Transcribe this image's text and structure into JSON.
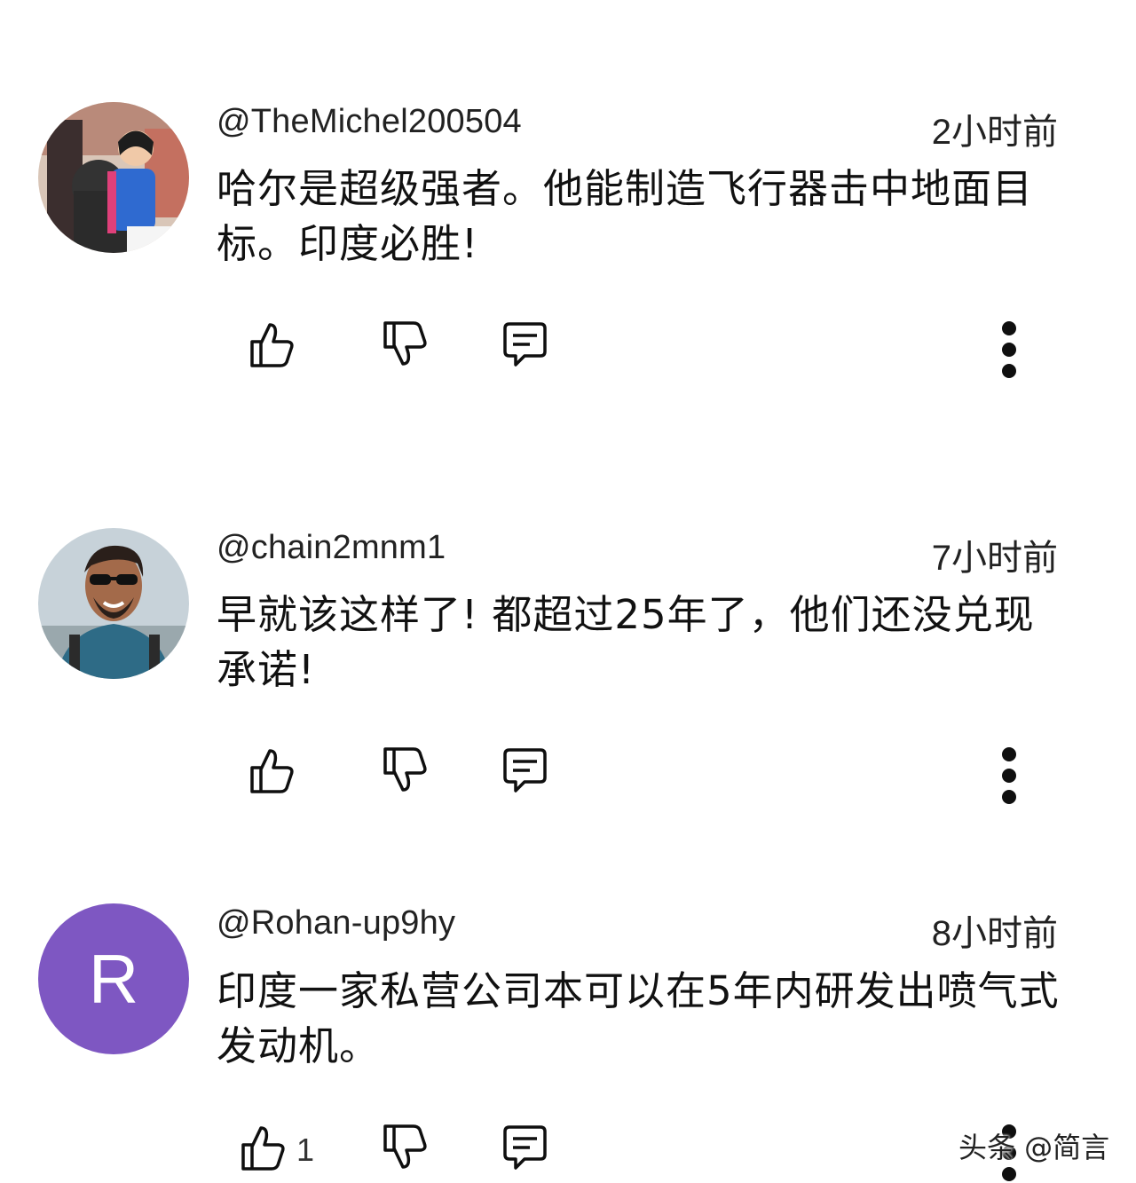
{
  "comments": [
    {
      "username": "@TheMichel200504",
      "time": "2小时前",
      "text": "哈尔是超级强者。他能制造飞行器击中地面目标。印度必胜!",
      "likes": "",
      "avatar_type": "photo"
    },
    {
      "username": "@chain2mnm1",
      "time": "7小时前",
      "text": "早就该这样了! 都超过25年了，他们还没兑现承诺!",
      "likes": "",
      "avatar_type": "photo"
    },
    {
      "username": "@Rohan-up9hy",
      "time": "8小时前",
      "text": "印度一家私营公司本可以在5年内研发出喷气式发动机。",
      "likes": "1",
      "avatar_type": "letter",
      "avatar_letter": "R",
      "avatar_color": "#7e57c2"
    }
  ],
  "icons": {
    "like": "thumb-up-icon",
    "dislike": "thumb-down-icon",
    "reply": "comment-icon",
    "more": "more-vert-icon"
  },
  "watermark": "头条 @简言"
}
